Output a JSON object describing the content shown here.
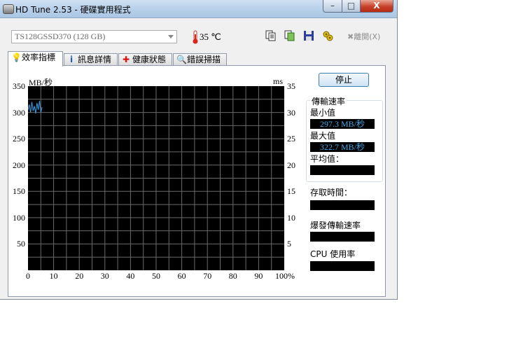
{
  "window": {
    "title": "HD Tune 2.53 - 硬碟實用程式"
  },
  "caption": {
    "minimize": "–",
    "maximize": "□",
    "close": "X"
  },
  "toolbar": {
    "drive": "TS128GSSD370 (128 GB)",
    "temperature": "35 ℃",
    "exit_label": "離開(X)"
  },
  "tabs": [
    {
      "label": "效率指標",
      "icon": "lightbulb-icon"
    },
    {
      "label": "訊息詳情",
      "icon": "info-icon"
    },
    {
      "label": "健康狀態",
      "icon": "red-cross-icon"
    },
    {
      "label": "錯誤掃描",
      "icon": "magnifier-icon"
    }
  ],
  "chart_data": {
    "type": "line",
    "ylabel_left": "MB/秒",
    "ylabel_right": "ms",
    "ylim_left": [
      0,
      350
    ],
    "ylim_right": [
      0,
      35
    ],
    "xlim": [
      0,
      100
    ],
    "left_ticks": [
      "350",
      "300",
      "250",
      "200",
      "150",
      "100",
      "50"
    ],
    "right_ticks": [
      "35",
      "30",
      "25",
      "20",
      "15",
      "10",
      "5"
    ],
    "x_ticks": [
      "0",
      "10",
      "20",
      "30",
      "40",
      "50",
      "60",
      "70",
      "80",
      "90",
      "100%"
    ],
    "grid": true,
    "series": [
      {
        "color": "#3aa0e8",
        "x": [
          0,
          0.5,
          1,
          1.5,
          2,
          2.5,
          3,
          3.5,
          4,
          4.5,
          5,
          5.5
        ],
        "y": [
          305,
          315,
          300,
          320,
          303,
          312,
          298,
          318,
          305,
          322,
          300,
          310
        ]
      }
    ]
  },
  "controls": {
    "stop_label": "停止"
  },
  "stats": {
    "transfer_title": "傳輸速率",
    "min_label": "最小值",
    "min_value": "297.3 MB/秒",
    "max_label": "最大值",
    "max_value": "322.7 MB/秒",
    "avg_label": "平均值：",
    "avg_value": "",
    "access_label": "存取時間：",
    "access_value": "",
    "burst_label": "爆發傳輸速率",
    "burst_value": "",
    "cpu_label": "CPU 使用率",
    "cpu_value": ""
  },
  "colors": {
    "line": "#3aa0e8",
    "value_text": "#41a8e6",
    "chart_bg": "#000000",
    "grid": "#6a6a6a"
  }
}
